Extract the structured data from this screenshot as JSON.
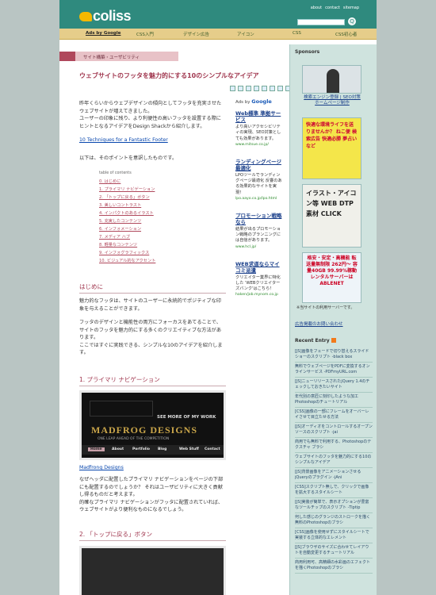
{
  "header": {
    "logo": "coliss",
    "toplinks": [
      "about",
      "contact",
      "sitemap"
    ],
    "search_button": "Q"
  },
  "nav": [
    "Ads by Google",
    "CSS入門",
    "デザイン広告",
    "アイコン",
    "CSS",
    "CSS初心者"
  ],
  "breadcrumb": "サイト構築・ユーザビリティ",
  "article": {
    "title": "ウェブサイトのフッタを魅力的にする10のシンプルなアイデア",
    "intro": "昨年くらいからウェブデザインの傾向としてフッタを充実させたウェブサイトが増えてきました。\nユーザーの印象に残り、より利便性の高いフッタを設置する際にヒントとなるアイデアをDesign Shackから紹介します。",
    "source_link": "10 Techniques for a Fantastic Footer",
    "lead": "以下は、そのポイントを意訳したものです。",
    "toc_title": "table of contents",
    "toc": [
      "0. はじめに",
      "1. プライマリ ナビゲーション",
      "2. 「トップに戻る」ボタン",
      "3. 美しいコントラスト",
      "4. インパクトのあるイラスト",
      "5. 充実したコンテンツ",
      "6. インフォメーション",
      "7. メディア ハブ",
      "8. 軽量なコンテンツ",
      "9. インフォグラフィックス",
      "10. ビジュアル的なアクセント"
    ],
    "sec0_head": "はじめに",
    "sec0_p1": "魅力的なフッタは、サイトのユーザーに永続的でポジティブな印象を与えることができます。",
    "sec0_p2": "フッタのデザインと機能性の両方にフォーカスをあてることで、サイトのフッタを魅力的にする多くのクリエイティブな方法があります。\nここではすぐに実践できる、シンプルな10のアイデアを紹介します。",
    "sec1_head": "1. プライマリ ナビゲーション",
    "sec1_caption": "Madfrong Designs",
    "sec1_text": "なぜヘッダに配置したプライマリ ナビゲーションをページの下部にも配置するのでしょうか？ それはユーザビリティに大きく貢献し得るものだと考えます。\n的確なプライマリ ナビゲーションがフッタに配置されていれば、ウェブサイトがより便利なものになるでしょう。",
    "sec2_head": "2. 「トップに戻る」ボタン",
    "shot1": {
      "menu": [
        "Home",
        "About",
        "Portfolio",
        "Blog",
        "Web Stuff",
        "Contact"
      ],
      "banner": "SEE MORE OF MY WORK",
      "logo": "MADFROG DESIGNS",
      "tagline": "ONE LEAP AHEAD OF THE COMPETITION"
    }
  },
  "ads": {
    "label_prefix": "Ads by",
    "label_brand": "Google",
    "items": [
      {
        "title": "Web標準 準拠サービス",
        "text": "より高いアクセシビリティの実現、SEO対策としても効果があります。",
        "url": "www.mitsue.co.jp/"
      },
      {
        "title": "ランディングページ最適化",
        "text": "LPOツールでランディングページ最適化 反響のある効果的なサイトを実現！",
        "url": "lpo.aayo.co.jp/lpo.html"
      },
      {
        "title": "プロモーション戦略なら",
        "text": "結果が出るプロモーション戦略のプランニングには自信があります。",
        "url": "www.hcl.jp/"
      },
      {
        "title": "WEB求道ならマイコミ派遣",
        "text": "クリエイター業界に特化した 'WEBクリエイターズバンク'はこちら！",
        "url": "haken/job.mynom.co.jp"
      }
    ]
  },
  "sidebar": {
    "sponsors_head": "Sponsors",
    "sponsor1_caption": "検索エンジン登録 | SEO対策\nホームページ制作",
    "banner2_text": "快適な環境ライフを送りませんか？ ねこ便 検索広告 快適必勝 夢占いなど",
    "banner3_text": "イラスト・アイコン等 WEB DTP 素材 CLICK",
    "banner4_text": "格安・安定・高機能 転送量無制限 262円〜 容量40GB 99.99%稼動 レンタルサーバーは ABLENET",
    "banner4_caption": "※当サイトの利用サーバーです。",
    "ad_link": "広告掲載のお問い合わせ",
    "recent_head": "Recent Entry",
    "recent": [
      "[JS]画像をフェードで切り替えるスライドショーのスクリプト -black box",
      "無料でウェブページをPDFに変換するオンラインサービス -PDFmyURL.com",
      "[JS]ニューリリースされたjQuery 1.4のチェックしておきたいサイト",
      "年代別の意匠に刻印したような加工Photoshopのチュートリアル",
      "[CSS]画像の一部にフレームをオーバーレイさせて目立たせる方法",
      "[JS]オーディオをコントロールするオープンソースのスクリプト -jai",
      "商用でも無料で利用する、Photoshopのテクスチャ ブラシ",
      "ウェブサイトのフッタを魅力的にする10のシンプルなアイデア",
      "[JS]背景画像をアニメーションさせるjQueryのプラグイン -jAni",
      "[CSS]スクリプト無しで、クリックで画像を拡大するスタイルシート",
      "[JS]実装が簡単で、表示オプションが豊富なツールチップのスクリプト -Tiptip",
      "何した感じのグランジのストロークを描く無料のPhotoshopのブラシ",
      "[CSS]画像を使用せずにスタイルシートで実装する立体的なエレメント",
      "[JS]ブラウザのサイズに合わせてレイアウトを自動変更するチュートリアル",
      "商用利用可、高精細の水彩画のエフェクトを描くPhotoshopのブラシ"
    ]
  }
}
